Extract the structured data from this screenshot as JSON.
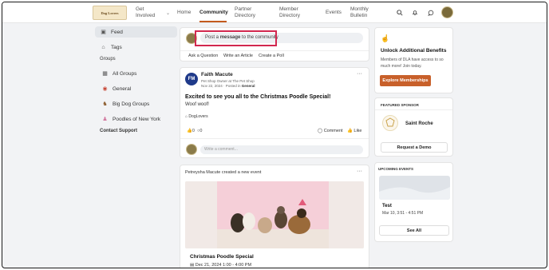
{
  "nav": {
    "logo_text": "Dog Lovers",
    "items": [
      "Get Involved",
      "Home",
      "Community",
      "Partner Directory",
      "Member Directory",
      "Events",
      "Monthly Bulletin"
    ],
    "get_involved_1": "Get",
    "get_involved_2": "Involved",
    "home": "Home",
    "community": "Community",
    "partner_1": "Partner",
    "partner_2": "Directory",
    "member_1": "Member",
    "member_2": "Directory",
    "events": "Events",
    "bulletin_1": "Monthly",
    "bulletin_2": "Bulletin"
  },
  "sidebar": {
    "feed": "Feed",
    "tags": "Tags",
    "groups_heading": "Groups",
    "all_groups": "All Groups",
    "general": "General",
    "big_dog_groups": "Big Dog Groups",
    "poodles": "Poodles of New York",
    "contact_support": "Contact Support"
  },
  "composer": {
    "placeholder_prefix": "Post a ",
    "placeholder_bold": "message",
    "placeholder_suffix": " to the community",
    "ask": "Ask a Question",
    "article": "Write an Article",
    "poll": "Create a Poll"
  },
  "post1": {
    "avatar_initials": "FM",
    "author": "Faith Macute",
    "role": "Pet Shop Owner at The Pet Shop",
    "meta_prefix": "Nov 22, 2024 · Posted in ",
    "meta_group": "General",
    "title": "Excited to see you all to the Christmas Poodle Special!",
    "body": "Woof woof!",
    "tag": "DogLovers",
    "likes": "0",
    "comments": "0",
    "comment_label": "Comment",
    "like_label": "Like",
    "comment_placeholder": "Write a comment..."
  },
  "post2": {
    "author": "Petreysha Macute",
    "action": " created a new event",
    "event_title": "Christmas Poodle Special",
    "event_date": "Dec 21, 2024 1:00 - 4:00 PM"
  },
  "benefits": {
    "title": "Unlock Additional Benefits",
    "text_1": "Members of DLA have access to so",
    "text_2": "much more! Join today.",
    "button": "Explore Memberships"
  },
  "sponsor": {
    "heading": "FEATURED SPONSOR",
    "name": "Saint Roche",
    "button": "Request a Demo"
  },
  "events": {
    "heading": "UPCOMING EVENTS",
    "event_name": "Test",
    "event_date": "Mar 10, 3:51 - 4:51 PM",
    "button": "See All"
  },
  "colors": {
    "accent": "#c8602a",
    "highlight": "#d2284f",
    "active_underline": "#c35a1d"
  }
}
